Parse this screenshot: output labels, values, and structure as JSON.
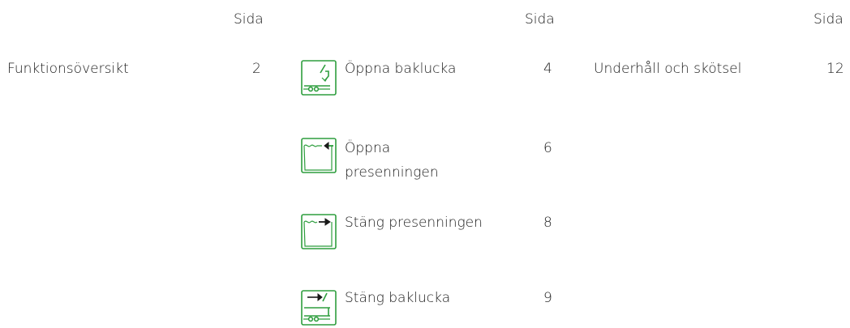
{
  "columns": [
    {
      "header": "Sida",
      "entries": [
        {
          "label": "Funktionsöversikt",
          "page": "2"
        }
      ]
    },
    {
      "header": "Sida",
      "entries": [
        {
          "icon": "open-tailgate-icon",
          "label": "Öppna baklucka",
          "page": "4"
        },
        {
          "icon": "open-tarpaulin-icon",
          "label_line1": "Öppna",
          "label_line2": "presenningen",
          "page": "6"
        },
        {
          "icon": "close-tarpaulin-icon",
          "label": "Stäng presenningen",
          "page": "8"
        },
        {
          "icon": "close-tailgate-icon",
          "label": "Stäng baklucka",
          "page": "9"
        }
      ]
    },
    {
      "header": "Sida",
      "entries": [
        {
          "label": "Underhåll och skötsel",
          "page": "12"
        }
      ]
    }
  ],
  "colors": {
    "icon": "#2e9e3e",
    "text": "#1a1a1a"
  }
}
